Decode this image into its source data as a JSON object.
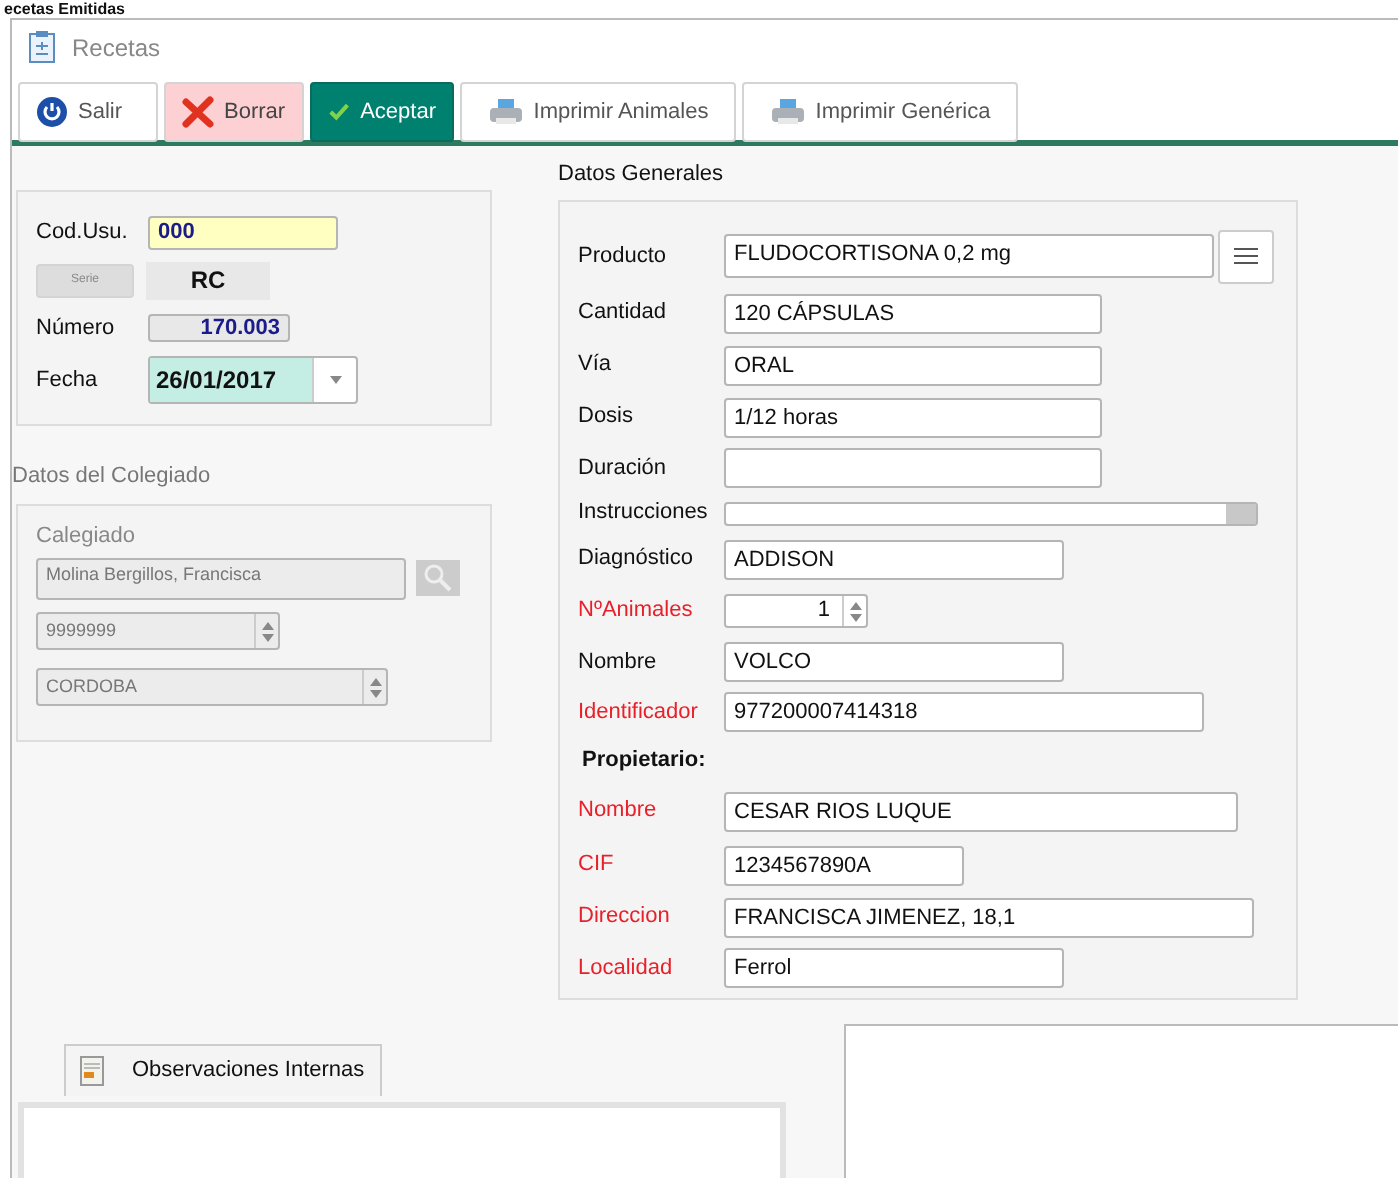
{
  "background_window": {
    "title": "ecetas Emitidas"
  },
  "window": {
    "title": "Recetas"
  },
  "toolbar": [
    {
      "label": "Salir",
      "kind": "exit"
    },
    {
      "label": "Borrar",
      "kind": "delete"
    },
    {
      "label": "Aceptar",
      "kind": "accept"
    },
    {
      "label": "Imprimir Animales",
      "kind": "print"
    },
    {
      "label": "Imprimir Genérica",
      "kind": "print"
    }
  ],
  "header": {
    "cod_usu": {
      "label": "Cod.Usu.",
      "value": "000"
    },
    "serie": {
      "label": "Serie",
      "value": "RC"
    },
    "numero": {
      "label": "Número",
      "value": "170.003"
    },
    "fecha": {
      "label": "Fecha",
      "value": "26/01/2017"
    }
  },
  "colegiado": {
    "title": "Datos del Colegiado",
    "label": "Calegiado",
    "name": "Molina Bergillos, Francisca",
    "number": "9999999",
    "province": "CORDOBA",
    "disabled": true
  },
  "general": {
    "title": "Datos Generales",
    "fields": [
      {
        "kind": "product",
        "label": "Producto",
        "value": "FLUDOCORTISONA 0,2 mg",
        "required": false
      },
      {
        "kind": "text",
        "label": "Cantidad",
        "value": "120 CÁPSULAS",
        "required": false
      },
      {
        "kind": "text",
        "label": "Vía",
        "value": "ORAL",
        "required": false
      },
      {
        "kind": "text",
        "label": "Dosis",
        "value": "1/12 horas",
        "required": false
      },
      {
        "kind": "text",
        "label": "Duración",
        "required": false
      },
      {
        "kind": "combo",
        "label": "Instrucciones",
        "required": false
      },
      {
        "kind": "text",
        "label": "Diagnóstico",
        "value": "ADDISON",
        "required": false
      },
      {
        "kind": "spin",
        "label": "NºAnimales",
        "value": "1",
        "required": true
      },
      {
        "kind": "text",
        "label": "Nombre",
        "value": "VOLCO",
        "required": false
      },
      {
        "kind": "text",
        "label": "Identificador",
        "value": "977200007414318",
        "required": true
      },
      {
        "kind": "heading",
        "label": "Propietario:"
      },
      {
        "kind": "text",
        "label": "Nombre",
        "value": "CESAR RIOS LUQUE",
        "required": true
      },
      {
        "kind": "text",
        "label": "CIF",
        "value": "1234567890A",
        "required": true
      },
      {
        "kind": "text",
        "label": "Direccion",
        "value": "FRANCISCA JIMENEZ, 18,1",
        "required": true
      },
      {
        "kind": "text",
        "label": "Localidad",
        "value": "Ferrol",
        "required": true
      }
    ]
  },
  "notes_tab": {
    "label": "Observaciones Internas"
  }
}
